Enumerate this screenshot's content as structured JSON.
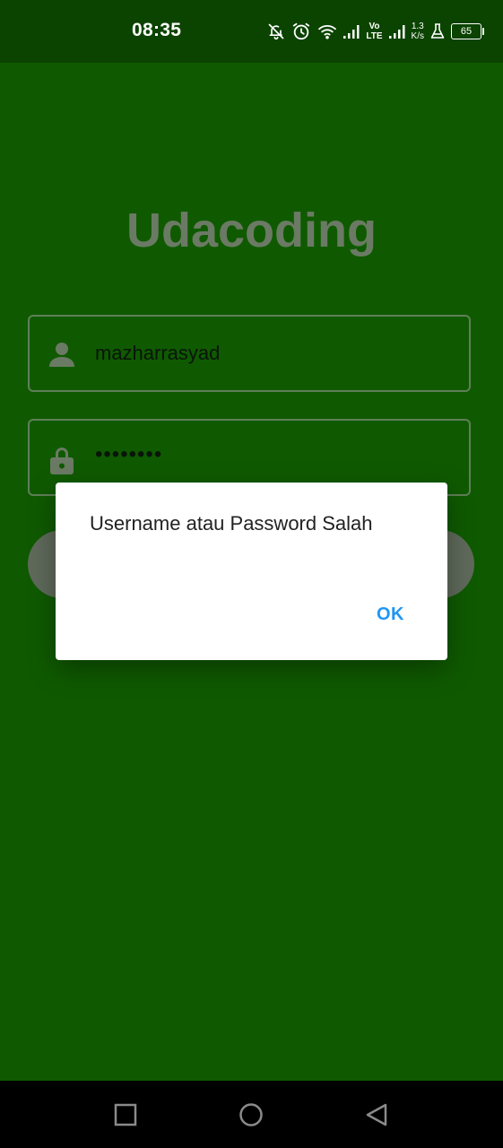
{
  "status_bar": {
    "time": "08:35",
    "volte_top": "Vo",
    "volte_bottom": "LTE",
    "net_speed_value": "1.3",
    "net_speed_unit": "K/s",
    "battery_level": "65",
    "icons": [
      "notifications-off-icon",
      "alarm-icon",
      "wifi-icon",
      "signal-icon",
      "signal-icon",
      "flask-icon",
      "battery-icon"
    ]
  },
  "app": {
    "title": "Udacoding",
    "username_value": "mazharrasyad",
    "password_value": "••••••••",
    "username_icon": "person-icon",
    "password_icon": "lock-icon",
    "colors": {
      "background": "#0f5a00",
      "status_bar": "#0b4300",
      "title": "#6b7a64",
      "accent": "#2196f3"
    }
  },
  "dialog": {
    "message": "Username atau Password Salah",
    "ok_label": "OK"
  },
  "nav_bar": {
    "icons": [
      "recent-apps-icon",
      "home-icon",
      "back-icon"
    ]
  }
}
